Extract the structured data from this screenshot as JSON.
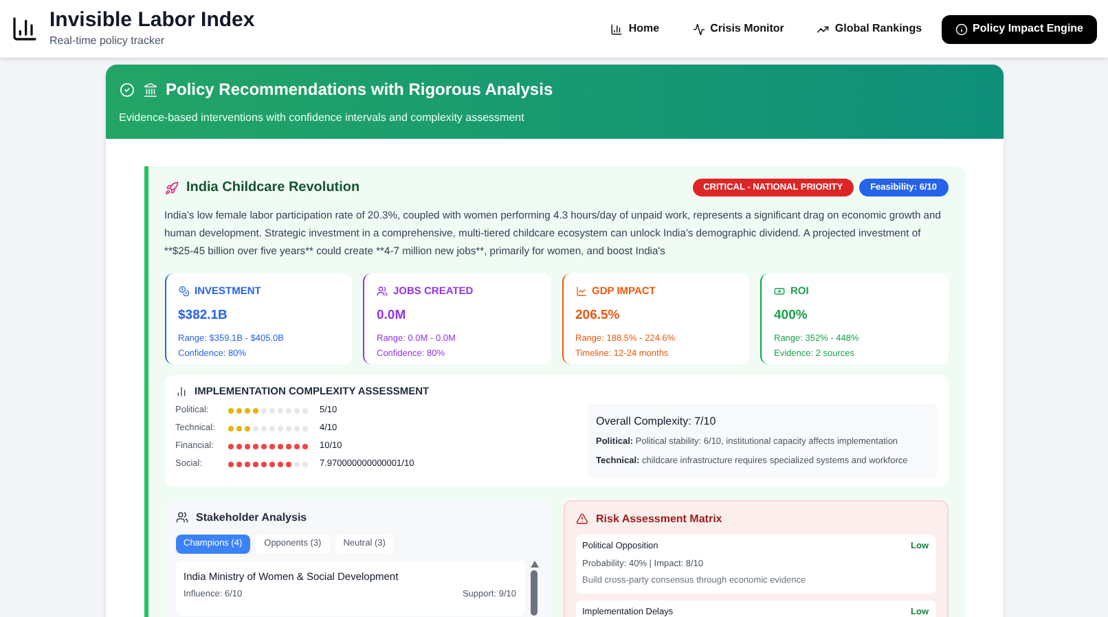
{
  "header": {
    "title": "Invisible Labor Index",
    "subtitle": "Real-time policy tracker",
    "nav": [
      {
        "label": "Home",
        "selected": false
      },
      {
        "label": "Crisis Monitor",
        "selected": false
      },
      {
        "label": "Global Rankings",
        "selected": false
      },
      {
        "label": "Policy Impact Engine",
        "selected": true
      }
    ]
  },
  "banner": {
    "title": "Policy Recommendations with Rigorous Analysis",
    "subtitle": "Evidence-based interventions with confidence intervals and complexity assessment"
  },
  "policy": {
    "title": "India Childcare Revolution",
    "badges": [
      {
        "label": "CRITICAL - NATIONAL PRIORITY",
        "color": "#dc2626"
      },
      {
        "label": "Feasibility: 6/10",
        "color": "#2563eb"
      }
    ],
    "description": "India's low female labor participation rate of 20.3%, coupled with women performing 4.3 hours/day of unpaid work, represents a significant drag on economic growth and human development. Strategic investment in a comprehensive, multi-tiered childcare ecosystem can unlock India's demographic dividend. A projected investment of **$25-45 billion over five years** could create **4-7 million new jobs**, primarily for women, and boost India's",
    "metrics": [
      {
        "label": "INVESTMENT",
        "value": "$382.1B",
        "line1": "Range: $359.1B - $405.0B",
        "line2": "Confidence: 80%",
        "color": "#2563eb"
      },
      {
        "label": "JOBS CREATED",
        "value": "0.0M",
        "line1": "Range: 0.0M - 0.0M",
        "line2": "Confidence: 80%",
        "color": "#9333ea"
      },
      {
        "label": "GDP IMPACT",
        "value": "206.5%",
        "line1": "Range: 188.5% - 224.6%",
        "line2": "Timeline: 12-24 months",
        "color": "#ea580c"
      },
      {
        "label": "ROI",
        "value": "400%",
        "line1": "Range: 352% - 448%",
        "line2": "Evidence: 2 sources",
        "color": "#16a34a"
      }
    ],
    "complexity": {
      "title": "IMPLEMENTATION COMPLEXITY ASSESSMENT",
      "rows": [
        {
          "label": "Political:",
          "stars": 4,
          "score": "5/10",
          "color": "#eab308"
        },
        {
          "label": "Technical:",
          "stars": 3,
          "score": "4/10",
          "color": "#eab308"
        },
        {
          "label": "Financial:",
          "stars": 10,
          "score": "10/10",
          "color": "#ef4444"
        },
        {
          "label": "Social:",
          "stars": 8,
          "score": "7.970000000000001/10",
          "color": "#ef4444"
        }
      ],
      "overall": "Overall Complexity: 7/10",
      "notes": [
        {
          "label": "Political:",
          "text": "Political stability: 6/10, institutional capacity affects implementation"
        },
        {
          "label": "Technical:",
          "text": "childcare infrastructure requires specialized systems and workforce"
        }
      ]
    },
    "stakeholders": {
      "title": "Stakeholder Analysis",
      "tabs": [
        {
          "label": "Champions (4)",
          "selected": true
        },
        {
          "label": "Opponents (3)",
          "selected": false
        },
        {
          "label": "Neutral (3)",
          "selected": false
        }
      ],
      "items": [
        {
          "name": "India Ministry of Women & Social Development",
          "influence": "Influence: 6/10",
          "support": "Support: 9/10"
        }
      ]
    },
    "risks": {
      "title": "Risk Assessment Matrix",
      "items": [
        {
          "name": "Political Opposition",
          "level": "Low",
          "details": "Probability: 40% | Impact: 8/10",
          "mitigation": "Build cross-party consensus through economic evidence"
        },
        {
          "name": "Implementation Delays",
          "level": "Low"
        }
      ]
    }
  }
}
